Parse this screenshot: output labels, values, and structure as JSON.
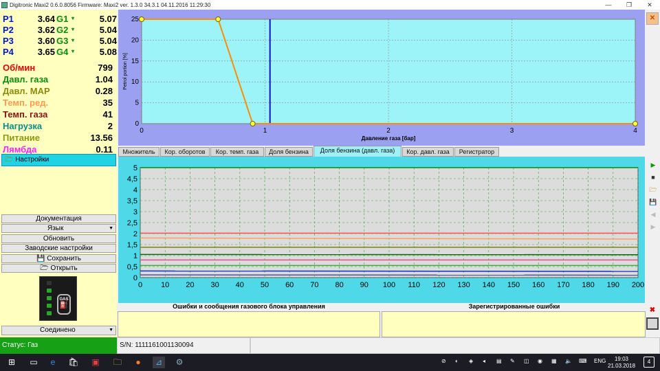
{
  "window": {
    "title": "Digitronic Maxi2 0.6.0.8056 Firmware: Maxi2  ver. 1.3.0  34.3.1   04.11.2016 11:29:30"
  },
  "injectors": [
    {
      "p": "P1",
      "pv": "3.64",
      "g": "G1",
      "gv": "5.07"
    },
    {
      "p": "P2",
      "pv": "3.62",
      "g": "G2",
      "gv": "5.04"
    },
    {
      "p": "P3",
      "pv": "3.60",
      "g": "G3",
      "gv": "5.04"
    },
    {
      "p": "P4",
      "pv": "3.65",
      "g": "G4",
      "gv": "5.08"
    }
  ],
  "metrics": [
    {
      "label": "Об/мин",
      "value": "799",
      "color": "#e00000"
    },
    {
      "label": "Давл. газа",
      "value": "1.04",
      "color": "#0a8a0a"
    },
    {
      "label": "Давл. MAP",
      "value": "0.28",
      "color": "#8a8a10"
    },
    {
      "label": "Темп. ред.",
      "value": "35",
      "color": "#ff9a50"
    },
    {
      "label": "Темп. газа",
      "value": "41",
      "color": "#8a1010"
    },
    {
      "label": "Нагрузка",
      "value": "2",
      "color": "#0a8a8a"
    },
    {
      "label": "Питание",
      "value": "13.56",
      "color": "#8a9a10"
    },
    {
      "label": "Лямбда",
      "value": "0.11",
      "color": "#ff20ff"
    }
  ],
  "sidebar": {
    "settings_label": "Настройки",
    "documentation": "Документация",
    "language": "Язык",
    "update": "Обновить",
    "factory": "Заводские настройки",
    "save": "Сохранить",
    "open": "Открыть",
    "connection": "Соединено"
  },
  "tabs": [
    "Множитель",
    "Кор. оборотов",
    "Кор. темп. газа",
    "Доля бензина",
    "Доля бензина (давл. газа)",
    "Кор. давл. газа",
    "Регистратор"
  ],
  "active_tab": 4,
  "errors": {
    "left_title": "Ошибки и сообщения газового блока управления",
    "right_title": "Зарегистрированные ошибки"
  },
  "status": {
    "text": "Статус: Газ",
    "serial": "S/N: 1111161001130094"
  },
  "taskbar": {
    "lang": "ENG",
    "time": "19:03",
    "date": "21.03.2018",
    "notifications": "4"
  },
  "chart_data": [
    {
      "type": "line",
      "xlabel": "Давление газа [бар]",
      "ylabel": "Petrol portion [%]",
      "xlim": [
        0,
        4
      ],
      "ylim": [
        0,
        25
      ],
      "xticks": [
        0,
        1,
        2,
        3,
        4
      ],
      "yticks": [
        0,
        5,
        10,
        15,
        20,
        25
      ],
      "series": [
        {
          "x": [
            0,
            0.62,
            0.9,
            4
          ],
          "y": [
            25,
            25,
            0,
            0
          ],
          "color": "#ff8c00"
        }
      ],
      "cursor_x": 1.04,
      "background": "#9cf4f8"
    },
    {
      "type": "line",
      "xlim": [
        0,
        200
      ],
      "ylim": [
        0,
        5
      ],
      "xticks": [
        0,
        10,
        20,
        30,
        40,
        50,
        60,
        70,
        80,
        90,
        100,
        110,
        120,
        130,
        140,
        150,
        160,
        170,
        180,
        190,
        200
      ],
      "yticks": [
        "0",
        "0,5",
        "1",
        "1,5",
        "2",
        "2,5",
        "3",
        "3,5",
        "4",
        "4,5",
        "5"
      ],
      "series": [
        {
          "color": "#0a8a0a",
          "y_start": 5.0,
          "y_end": 5.0
        },
        {
          "color": "#ff5050",
          "y_start": 2.02,
          "y_end": 2.02
        },
        {
          "color": "#ffa060",
          "y_start": 1.8,
          "y_end": 1.75
        },
        {
          "color": "#808010",
          "y_start": 1.38,
          "y_end": 1.38
        },
        {
          "color": "#0a6a0a",
          "y_start": 1.05,
          "y_end": 1.04
        },
        {
          "color": "#e05090",
          "y_start": 0.8,
          "y_end": 0.8
        },
        {
          "color": "#40b040",
          "y_start": 0.55,
          "y_end": 0.55
        },
        {
          "color": "#1030c0",
          "y_start": 0.3,
          "y_end": 0.28
        },
        {
          "color": "#5050a0",
          "y_start": 0.12,
          "y_end": 0.11
        }
      ]
    }
  ]
}
